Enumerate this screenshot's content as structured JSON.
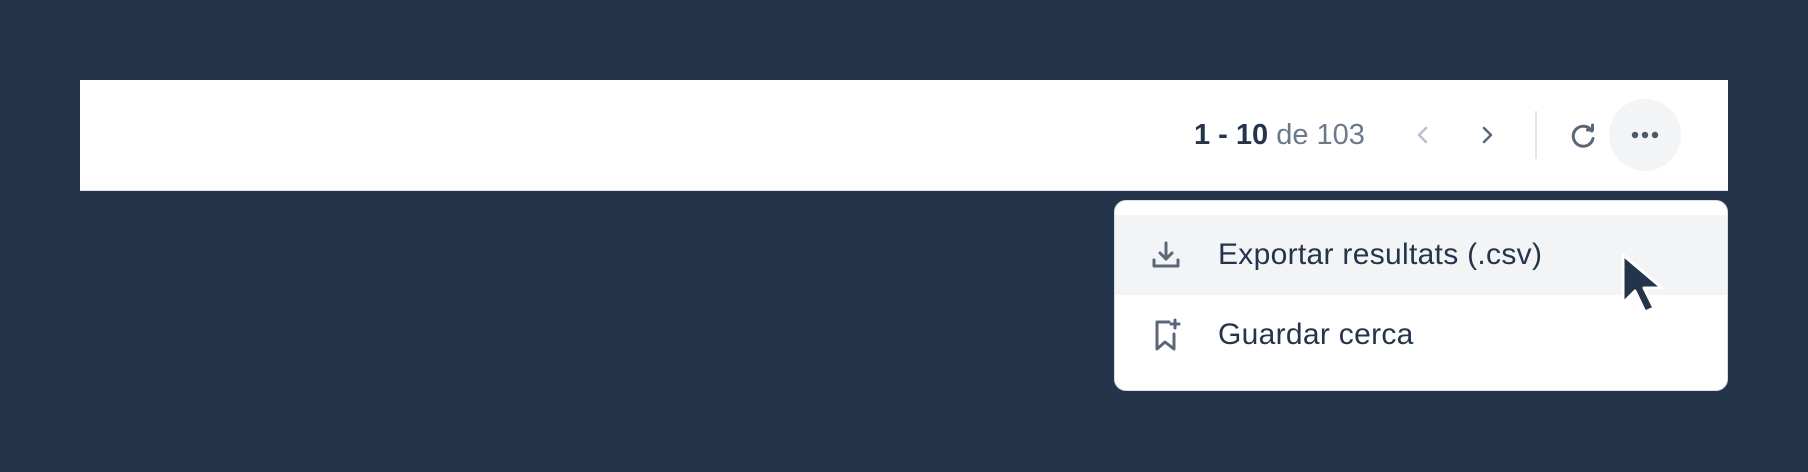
{
  "pagination": {
    "range": "1 - 10",
    "of_text": " de 103"
  },
  "toolbar": {
    "prev_icon": "chevron-left-icon",
    "next_icon": "chevron-right-icon",
    "refresh_icon": "refresh-icon",
    "more_icon": "more-horizontal-icon"
  },
  "dropdown": {
    "items": [
      {
        "label": "Exportar resultats (.csv)",
        "icon": "download-icon",
        "hovered": true
      },
      {
        "label": "Guardar cerca",
        "icon": "bookmark-plus-icon",
        "hovered": false
      }
    ]
  },
  "colors": {
    "background": "#24354b",
    "surface": "#ffffff",
    "text_primary": "#24354b",
    "text_secondary": "#6b7a8b",
    "hover": "#f2f4f6"
  }
}
